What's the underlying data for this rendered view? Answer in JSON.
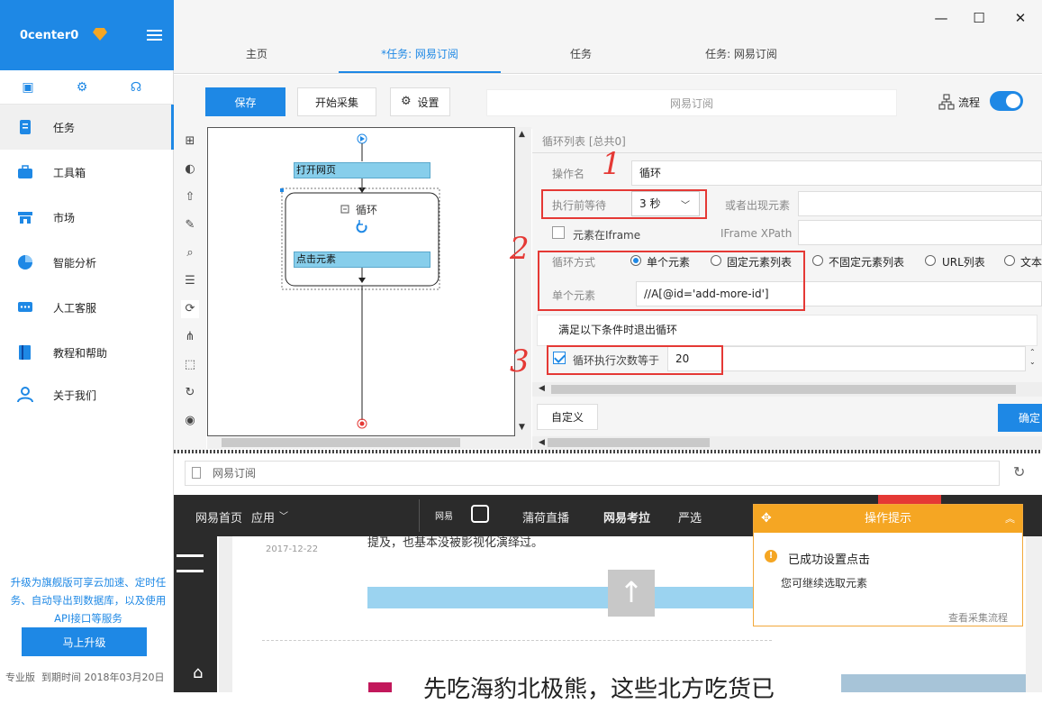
{
  "sidebar": {
    "brand": "0center0",
    "nav": [
      {
        "label": "任务",
        "icon": "task-icon",
        "active": true
      },
      {
        "label": "工具箱",
        "icon": "toolbox-icon"
      },
      {
        "label": "市场",
        "icon": "market-icon"
      },
      {
        "label": "智能分析",
        "icon": "pie-chart-icon"
      },
      {
        "label": "人工客服",
        "icon": "chat-icon"
      },
      {
        "label": "教程和帮助",
        "icon": "book-icon"
      },
      {
        "label": "关于我们",
        "icon": "user-icon"
      }
    ],
    "upgrade_text": "升级为旗舰版可享云加速、定时任务、自动导出到数据库，以及使用API接口等服务",
    "upgrade_button": "马上升级",
    "edition": "专业版",
    "expiry": "到期时间 2018年03月20日"
  },
  "window": {
    "min": "—",
    "max": "☐",
    "close": "✕"
  },
  "tabs": [
    "主页",
    "*任务: 网易订阅",
    "任务",
    "任务: 网易订阅"
  ],
  "toolbar": {
    "save": "保存",
    "start": "开始采集",
    "settings": "设置",
    "task_name": "网易订阅",
    "flow": "流程"
  },
  "flow": {
    "open_page": "打开网页",
    "loop": "循环",
    "click": "点击元素"
  },
  "panel": {
    "header": "循环列表 [总共0]",
    "op_name_label": "操作名",
    "op_name": "循环",
    "wait_label": "执行前等待",
    "wait_value": "3 秒",
    "or_element_label": "或者出现元素",
    "iframe_label": "元素在Iframe",
    "iframe_xpath_label": "IFrame XPath",
    "loop_mode_label": "循环方式",
    "modes": [
      "单个元素",
      "固定元素列表",
      "不固定元素列表",
      "URL列表",
      "文本"
    ],
    "single_label": "单个元素",
    "xpath": "//A[@id='add-more-id']",
    "exit_header": "满足以下条件时退出循环",
    "count_label": "循环执行次数等于",
    "count_value": "20",
    "custom": "自定义",
    "ok": "确定"
  },
  "annotations": [
    "1",
    "2",
    "3"
  ],
  "browser": {
    "url": "网易订阅",
    "nav": [
      "网易首页",
      "应用",
      "网易",
      "蒲荷直播",
      "网易考拉",
      "严选"
    ],
    "date": "2017-12-22",
    "snippet": "提及，也基本没被影视化演绎过。",
    "headline": "先吃海豹北极熊，这些北方吃货已"
  },
  "toast": {
    "title": "操作提示",
    "message": "已成功设置点击",
    "sub": "您可继续选取元素",
    "link": "查看采集流程"
  },
  "colors": {
    "accent": "#1e88e5",
    "warn": "#f5a623",
    "mark": "#e53935"
  }
}
